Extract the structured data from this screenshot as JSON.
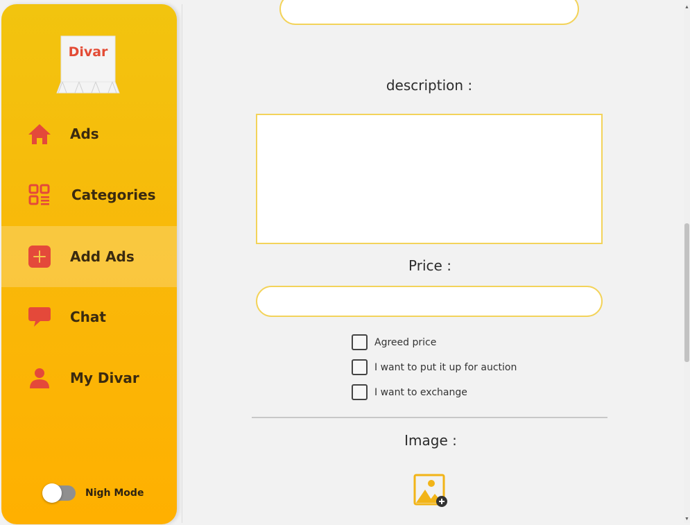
{
  "app": {
    "logo_text": "Divar",
    "accent_color": "#f5bd0c",
    "icon_color": "#e4493a"
  },
  "sidebar": {
    "items": [
      {
        "label": "Ads",
        "icon": "home-icon",
        "active": false
      },
      {
        "label": "Categories",
        "icon": "categories-grid-icon",
        "active": false
      },
      {
        "label": "Add Ads",
        "icon": "plus-square-icon",
        "active": true
      },
      {
        "label": "Chat",
        "icon": "chat-bubble-icon",
        "active": false
      },
      {
        "label": "My Divar",
        "icon": "user-icon",
        "active": false
      }
    ],
    "night_mode": {
      "label": "Nigh Mode",
      "enabled": false
    }
  },
  "form": {
    "top_field": {
      "value": ""
    },
    "description": {
      "label": "description :",
      "value": ""
    },
    "price": {
      "label": "Price :",
      "value": ""
    },
    "options": [
      {
        "label": "Agreed price",
        "checked": false
      },
      {
        "label": "I want to put it up for auction",
        "checked": false
      },
      {
        "label": "I want to exchange",
        "checked": false
      }
    ],
    "image": {
      "label": "Image :",
      "icon": "add-image-icon"
    }
  }
}
